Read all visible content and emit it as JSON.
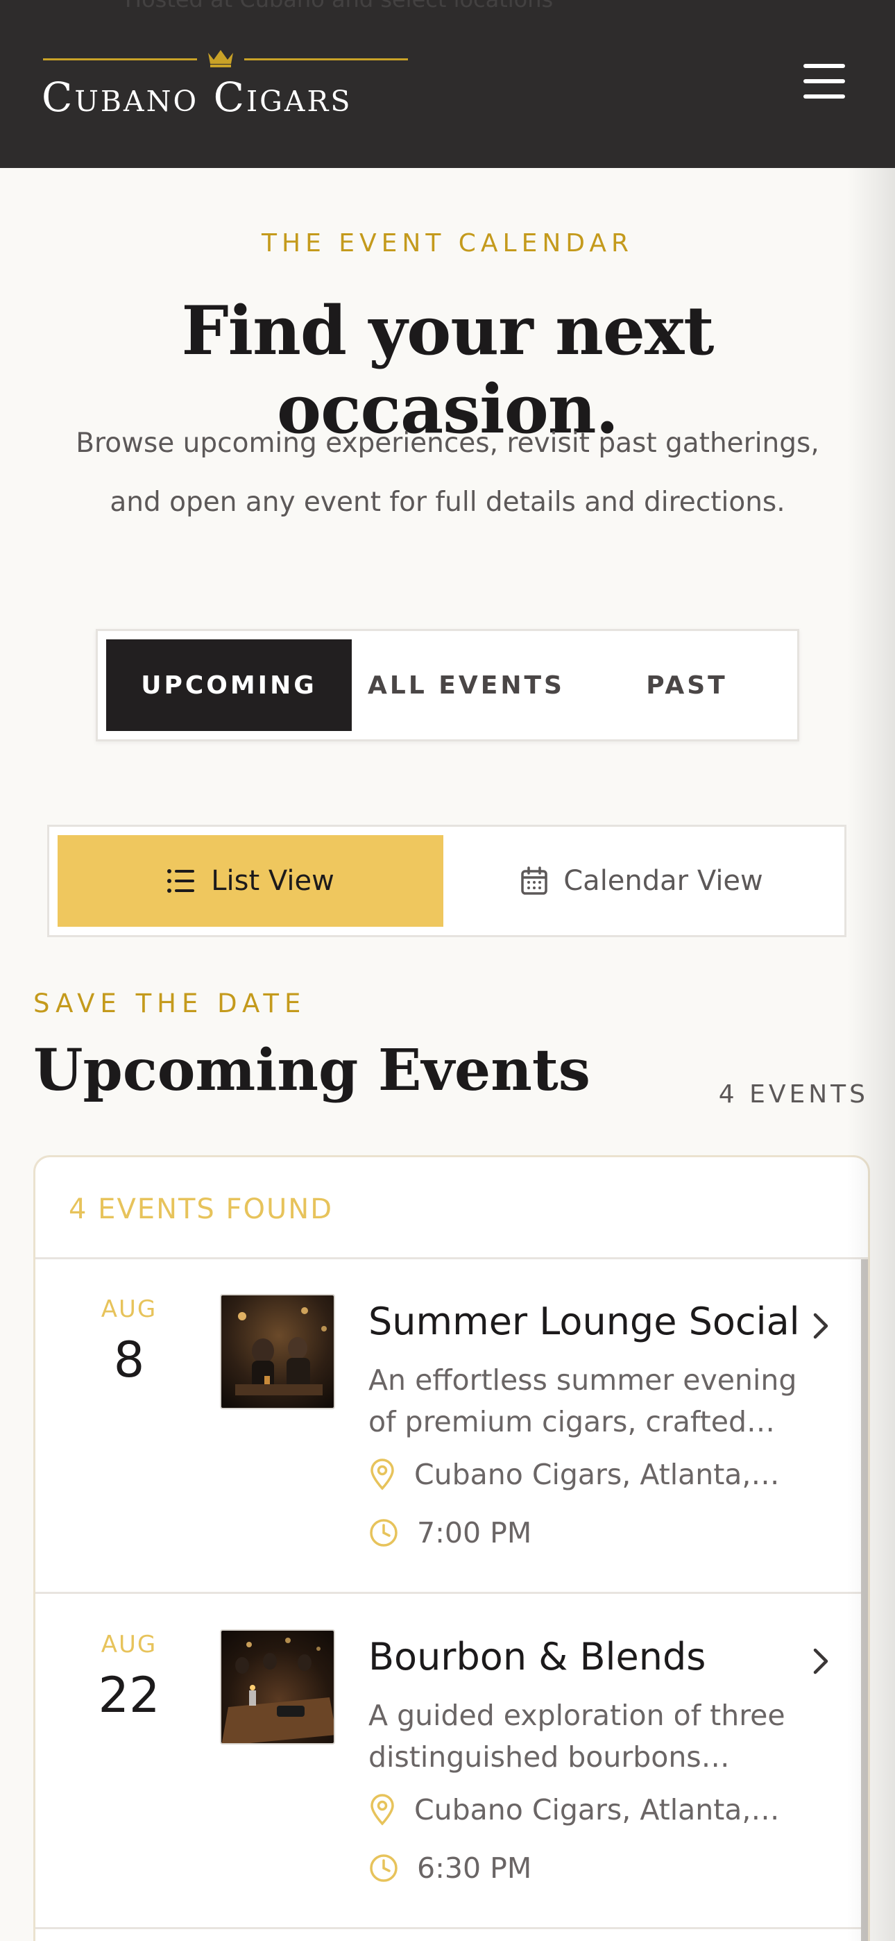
{
  "header": {
    "ghost_text": "Hosted at Cubano and select locations",
    "logo_text": "Cubano Cigars",
    "menu_icon": "hamburger-menu-icon"
  },
  "hero": {
    "eyebrow": "THE EVENT CALENDAR",
    "title": "Find your next occasion.",
    "description": "Browse upcoming experiences, revisit past gatherings, and open any event for full details and directions."
  },
  "tabs": [
    {
      "label": "UPCOMING",
      "active": true
    },
    {
      "label": "ALL EVENTS",
      "active": false
    },
    {
      "label": "PAST",
      "active": false
    }
  ],
  "views": [
    {
      "label": "List View",
      "icon": "list-icon",
      "active": true
    },
    {
      "label": "Calendar View",
      "icon": "calendar-icon",
      "active": false
    }
  ],
  "section": {
    "eyebrow": "SAVE THE DATE",
    "title": "Upcoming Events",
    "count": "4 EVENTS"
  },
  "events_list": {
    "found_label": "4 EVENTS FOUND",
    "items": [
      {
        "month": "AUG",
        "day": "8",
        "title": "Summer Lounge Social",
        "description": "An effortless summer evening of premium cigars, crafted…",
        "location": "Cubano Cigars, Atlanta,…",
        "time": "7:00 PM"
      },
      {
        "month": "AUG",
        "day": "22",
        "title": "Bourbon & Blends",
        "description": "A guided exploration of three distinguished bourbons…",
        "location": "Cubano Cigars, Atlanta,…",
        "time": "6:30 PM"
      }
    ]
  },
  "colors": {
    "header_bg": "#2e2c2c",
    "gold": "#c49a1c",
    "gold_light": "#e7c35b",
    "active_view_bg": "#efc75e",
    "active_tab_bg": "#221f20",
    "page_bg": "#faf9f6"
  }
}
